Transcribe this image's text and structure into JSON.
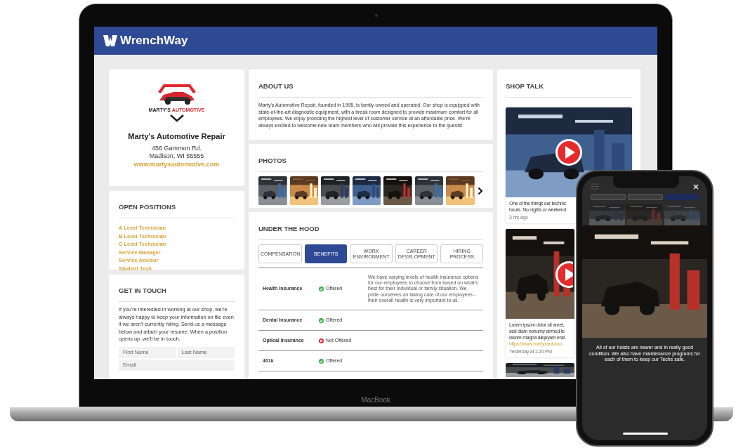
{
  "brand": {
    "name": "WrenchWay"
  },
  "profile": {
    "logo_text": [
      "MARTY'S",
      "AUTOMOTIVE"
    ],
    "name": "Marty's Automotive Repair",
    "address_line_1": "456 Gammon Rd.",
    "address_line_2": "Madison, WI 55555",
    "website": "www.martysautomotive.com"
  },
  "open_positions": {
    "title": "OPEN POSITIONS",
    "items": [
      "A Level Technician",
      "B Level Technician",
      "C Level Technician",
      "Service Manager",
      "Service Advisor",
      "Student Tech"
    ]
  },
  "get_in_touch": {
    "title": "GET IN TOUCH",
    "text": "If you're interested in working at our shop, we're always happy to keep your information on file even if we aren't currently hiring. Send us a message below and attach your resume. When a position opens up, we'll be in touch.",
    "fields": [
      {
        "placeholder": "First Name"
      },
      {
        "placeholder": "Last Name"
      },
      {
        "placeholder": "Email"
      }
    ]
  },
  "about": {
    "title": "ABOUT US",
    "text": "Marty's Automotive Repair, founded in 1995, is family owned and operated. Our shop is equipped with state-of-the-art diagnostic equipment, with a break room designed to provide maximum comfort for all employees. We enjoy providing the highest level of customer service at an affordable price. We're always excited to welcome new team members who will provide this experience to the guests!"
  },
  "photos": {
    "title": "PHOTOS"
  },
  "under_the_hood": {
    "title": "UNDER THE HOOD",
    "tabs": [
      {
        "label": "COMPENSATION",
        "selected": false
      },
      {
        "label": "BENEFITS",
        "selected": true
      },
      {
        "label": "WORK ENVIRONMENT",
        "selected": false
      },
      {
        "label": "CAREER DEVELOPMENT",
        "selected": false
      },
      {
        "label": "HIRING PROCESS",
        "selected": false
      }
    ],
    "rows": [
      {
        "name": "Health Insurance",
        "offered": true,
        "status": "Offered",
        "note": "We have varying levels of health insurance options for our employees to choose from based on what's best for their individual or family situation. We pride ourselves on taking care of our employees - their overall health is very important to us."
      },
      {
        "name": "Dental Insurance",
        "offered": true,
        "status": "Offered"
      },
      {
        "name": "Optical Insurance",
        "offered": false,
        "status": "Not Offered"
      },
      {
        "name": "401k",
        "offered": true,
        "status": "Offered"
      }
    ]
  },
  "shop_talk": {
    "title": "SHOP TALK",
    "posts": [
      {
        "lines": [
          "One of the things our technic",
          "hours. No nights or weekend"
        ],
        "time": "3 hrs ago"
      },
      {
        "lines": [
          "Lorem ipsum dolor sit amet,",
          "sed diam nonumy eirmod te",
          "dolore magna aliquyam erat."
        ],
        "link": "https://www.martysautomo",
        "time": "Yesterday at 1:20 PM"
      }
    ]
  },
  "phone": {
    "tabs": [
      {
        "selected": false
      },
      {
        "selected": false
      },
      {
        "selected": true
      }
    ],
    "caption": "All of our hoists are newer and in really good condition. We also have maintenance programs for each of them to keep our Techs safe."
  },
  "device": {
    "label": "MacBook"
  }
}
